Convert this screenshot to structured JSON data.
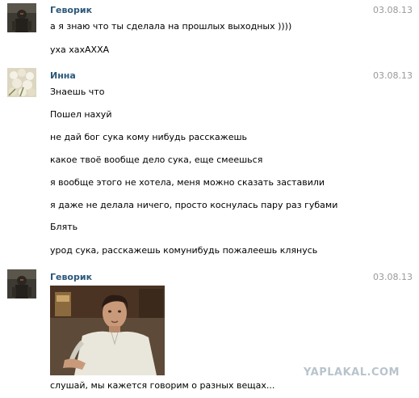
{
  "messages": [
    {
      "author": "Геворик",
      "date": "03.08.13",
      "lines": [
        "а я знаю что ты сделала на прошлых выходных ))))",
        "уха хахАХХА"
      ]
    },
    {
      "author": "Инна",
      "date": "03.08.13",
      "lines": [
        "Знаешь что",
        "Пошел нахуй",
        "не дай бог сука кому нибудь расскажешь",
        "какое твоё вообще дело сука, еще смеешься",
        "я вообще этого не хотела, меня можно сказать заставили",
        "я даже не делала ничего, просто коснулась пару раз губами",
        "Блять",
        "урод сука, расскажешь комунибудь пожалеешь клянусь"
      ]
    },
    {
      "author": "Геворик",
      "date": "03.08.13",
      "lines": [
        "слушай, мы кажется говорим о разных вещах..."
      ]
    }
  ],
  "watermark": "YAPLAKAL.COM",
  "colors": {
    "author_name": "#2b587a",
    "date": "#999999",
    "text": "#000000",
    "watermark": "#b8c4cc"
  }
}
